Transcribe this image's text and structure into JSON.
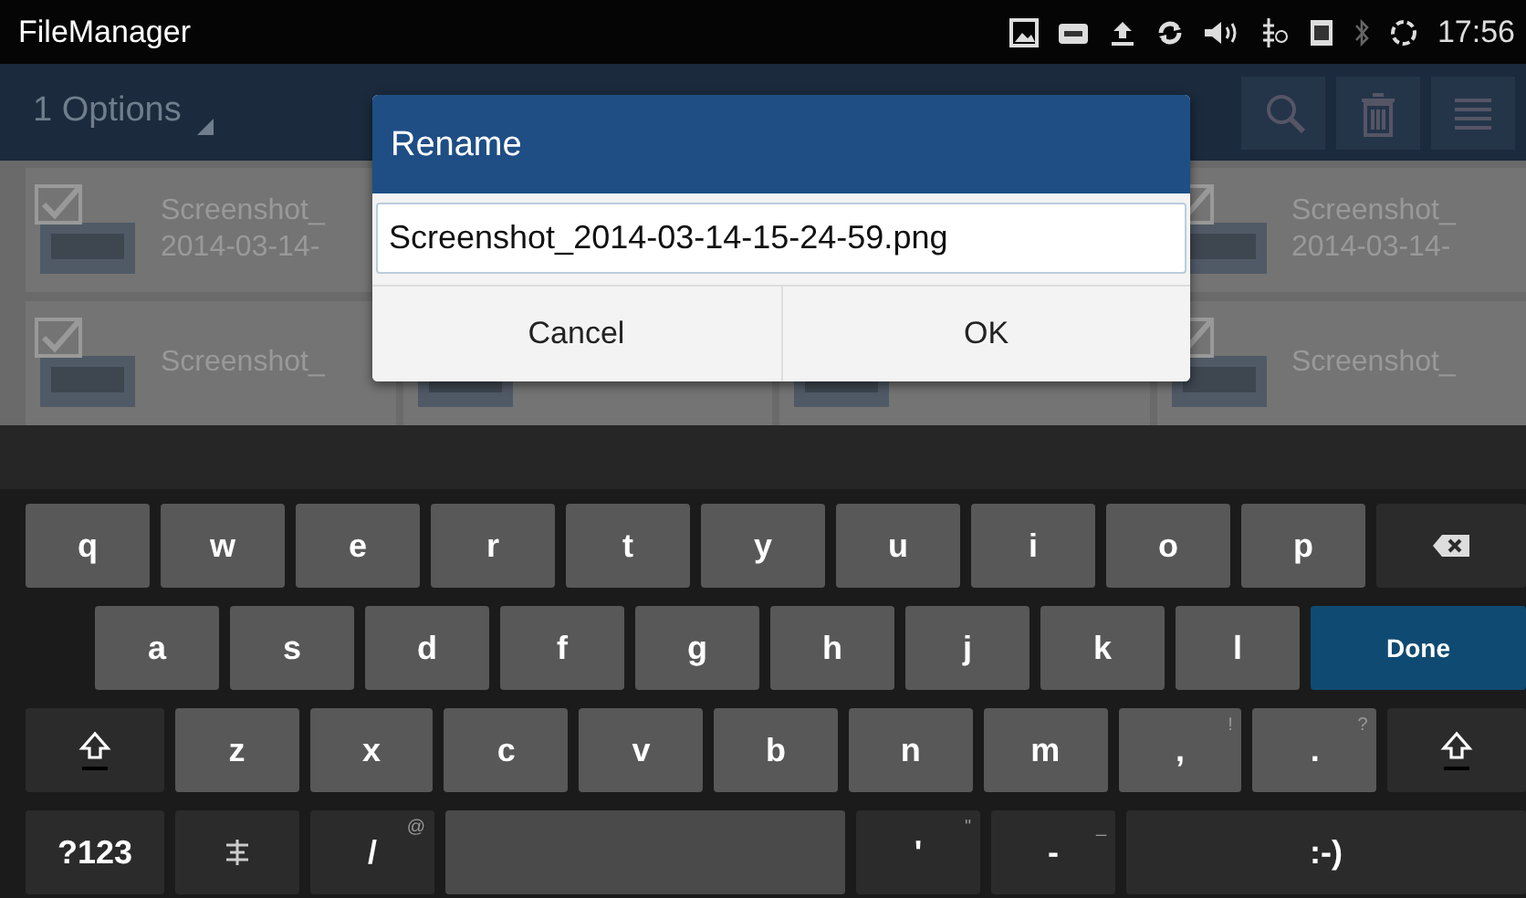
{
  "status_bar": {
    "app_title": "FileManager",
    "time": "17:56"
  },
  "action_bar": {
    "selection": "1 Options"
  },
  "files": [
    {
      "kind": "file",
      "lines": [
        "Screenshot_",
        "2014-03-14-"
      ],
      "checked": true
    },
    {
      "kind": "file",
      "lines": [
        "Screenshot_",
        "2014-03-14-"
      ],
      "checked": true
    },
    {
      "kind": "file",
      "lines": [
        "Screenshot_"
      ],
      "checked": true
    },
    {
      "kind": "covered"
    },
    {
      "kind": "covered"
    },
    {
      "kind": "file",
      "lines": [
        "Screenshot_"
      ],
      "checked": true
    }
  ],
  "dialog": {
    "title": "Rename",
    "value": "Screenshot_2014-03-14-15-24-59.png",
    "buttons": [
      "Cancel",
      "OK"
    ]
  },
  "keyboard": {
    "rows": [
      [
        {
          "kind": "letter",
          "label": "q"
        },
        {
          "kind": "letter",
          "label": "w"
        },
        {
          "kind": "letter",
          "label": "e"
        },
        {
          "kind": "letter",
          "label": "r"
        },
        {
          "kind": "letter",
          "label": "t"
        },
        {
          "kind": "letter",
          "label": "y"
        },
        {
          "kind": "letter",
          "label": "u"
        },
        {
          "kind": "letter",
          "label": "i"
        },
        {
          "kind": "letter",
          "label": "o"
        },
        {
          "kind": "letter",
          "label": "p"
        },
        {
          "kind": "backspace"
        }
      ],
      [
        {
          "kind": "letter",
          "label": "a"
        },
        {
          "kind": "letter",
          "label": "s"
        },
        {
          "kind": "letter",
          "label": "d"
        },
        {
          "kind": "letter",
          "label": "f"
        },
        {
          "kind": "letter",
          "label": "g"
        },
        {
          "kind": "letter",
          "label": "h"
        },
        {
          "kind": "letter",
          "label": "j"
        },
        {
          "kind": "letter",
          "label": "k"
        },
        {
          "kind": "letter",
          "label": "l"
        },
        {
          "kind": "done",
          "label": "Done"
        }
      ],
      [
        {
          "kind": "shift"
        },
        {
          "kind": "letter",
          "label": "z"
        },
        {
          "kind": "letter",
          "label": "x"
        },
        {
          "kind": "letter",
          "label": "c"
        },
        {
          "kind": "letter",
          "label": "v"
        },
        {
          "kind": "letter",
          "label": "b"
        },
        {
          "kind": "letter",
          "label": "n"
        },
        {
          "kind": "letter",
          "label": "m"
        },
        {
          "kind": "letter",
          "label": ",",
          "hint": "!"
        },
        {
          "kind": "letter",
          "label": ".",
          "hint": "?"
        },
        {
          "kind": "shift"
        }
      ],
      [
        {
          "kind": "action",
          "label": "?123"
        },
        {
          "kind": "settings"
        },
        {
          "kind": "action",
          "label": "/",
          "hint": "@"
        },
        {
          "kind": "space"
        },
        {
          "kind": "action",
          "label": "'",
          "hint": "\""
        },
        {
          "kind": "action",
          "label": "-",
          "hint": "_"
        },
        {
          "kind": "action",
          "label": ":-)"
        }
      ]
    ]
  }
}
